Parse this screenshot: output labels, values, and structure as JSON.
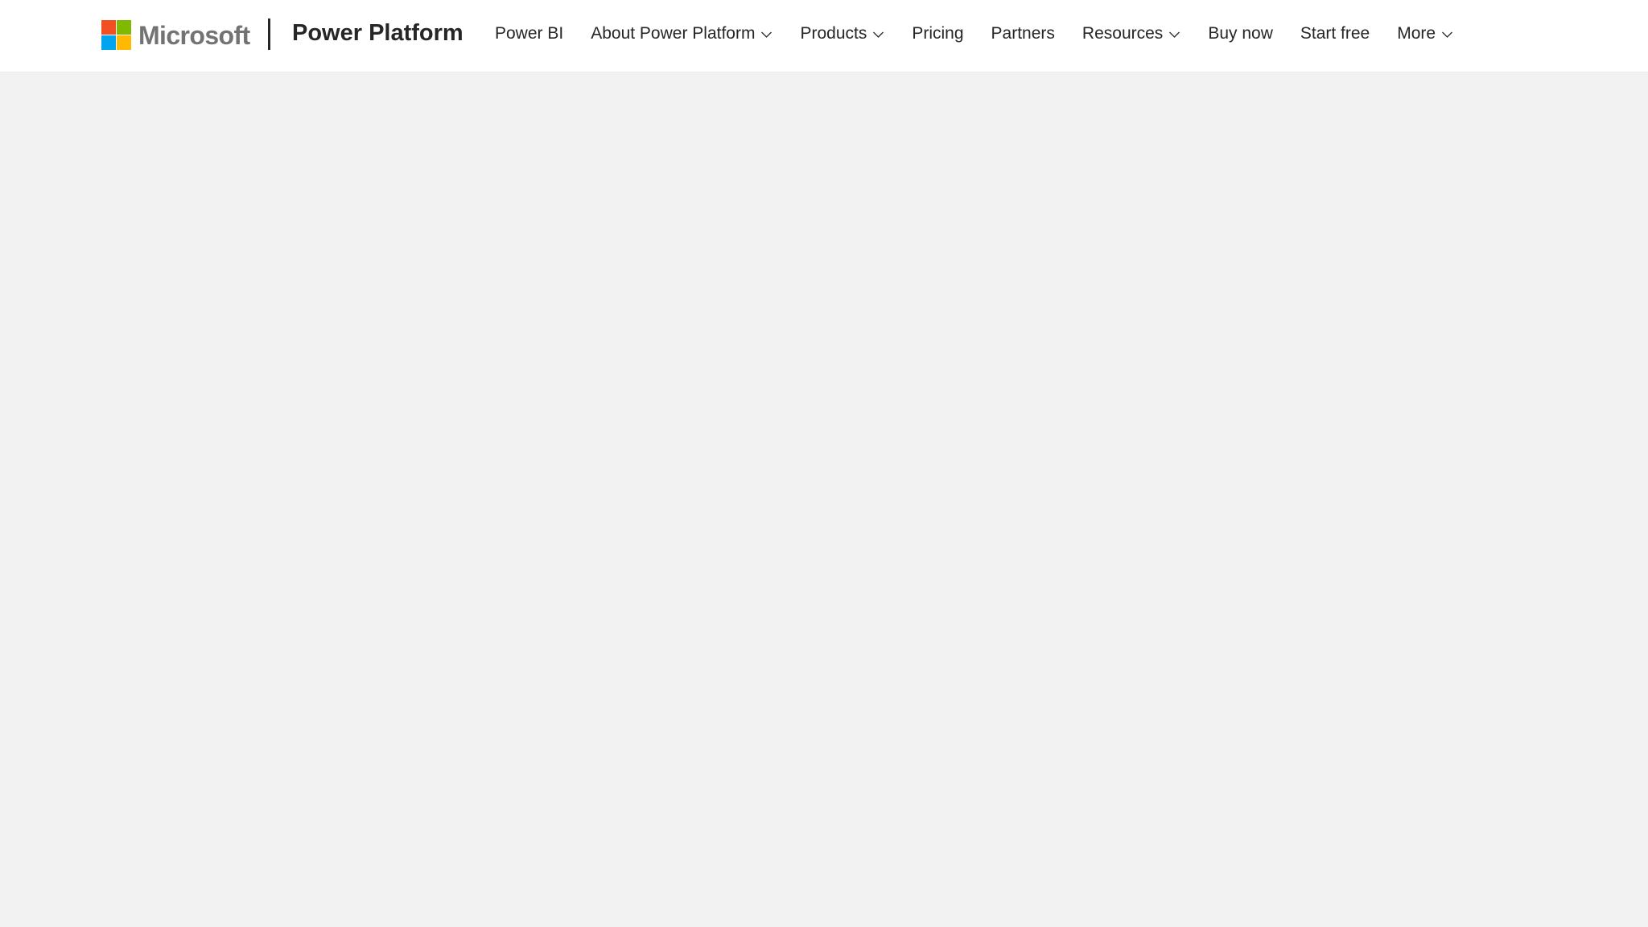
{
  "header": {
    "brand": {
      "wordmark": "Microsoft",
      "logo_colors": [
        "#f25022",
        "#7fba00",
        "#00a4ef",
        "#ffb900"
      ]
    },
    "product_name": "Power Platform",
    "nav": {
      "power_bi": "Power BI",
      "about": "About Power Platform",
      "products": "Products",
      "pricing": "Pricing",
      "partners": "Partners",
      "resources": "Resources",
      "buy_now": "Buy now",
      "start_free": "Start free",
      "more": "More"
    },
    "icons": {
      "dropdown": "chevron-down-icon"
    }
  },
  "colors": {
    "header_background": "#ffffff",
    "page_background": "#f2f2f2",
    "text": "#262626",
    "wordmark": "#737373"
  }
}
